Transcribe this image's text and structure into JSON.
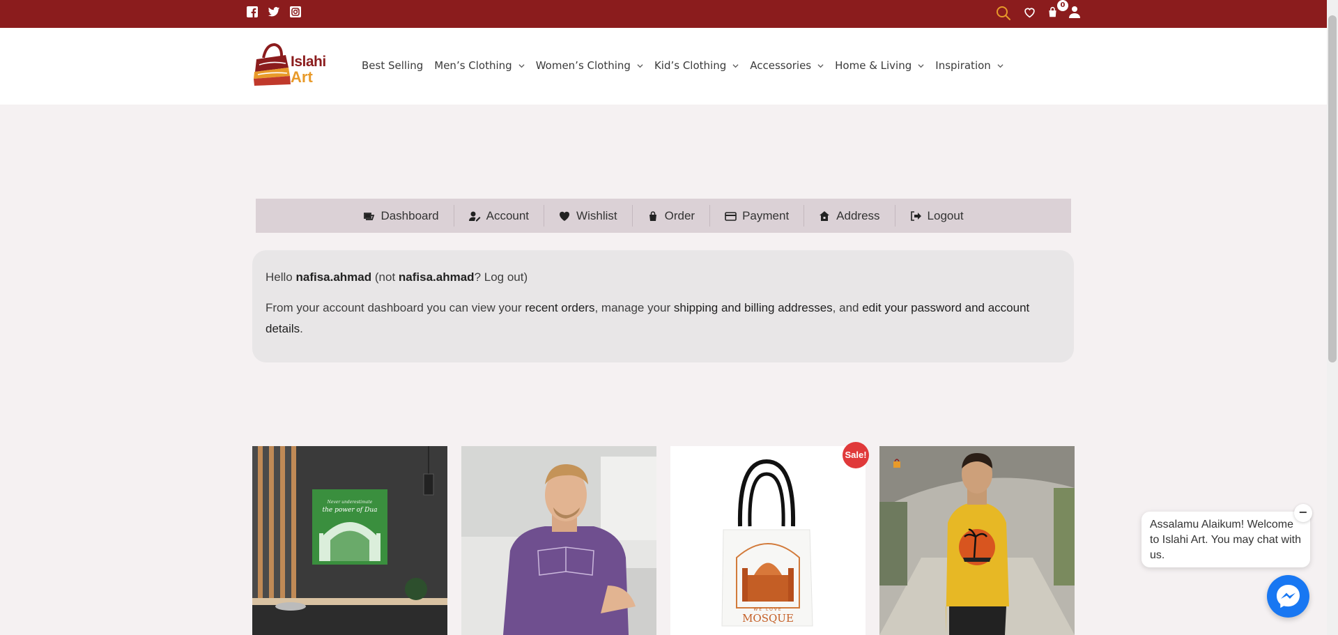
{
  "social": [
    {
      "icon": "facebook-icon"
    },
    {
      "icon": "twitter-icon"
    },
    {
      "icon": "instagram-icon"
    }
  ],
  "top": {
    "cart_count": "0"
  },
  "brand": {
    "line1": "Islahi",
    "line2": "Art"
  },
  "nav": [
    {
      "label": "Best Selling",
      "dropdown": false
    },
    {
      "label": "Men’s Clothing",
      "dropdown": true
    },
    {
      "label": "Women’s Clothing",
      "dropdown": true
    },
    {
      "label": "Kid’s Clothing",
      "dropdown": true
    },
    {
      "label": "Accessories",
      "dropdown": true
    },
    {
      "label": "Home & Living",
      "dropdown": true
    },
    {
      "label": "Inspiration",
      "dropdown": true
    }
  ],
  "account_tabs": [
    {
      "label": "Dashboard",
      "icon": "dashboard-icon"
    },
    {
      "label": "Account",
      "icon": "user-edit-icon"
    },
    {
      "label": "Wishlist",
      "icon": "heart-icon"
    },
    {
      "label": "Order",
      "icon": "shopping-bag-icon"
    },
    {
      "label": "Payment",
      "icon": "credit-card-icon"
    },
    {
      "label": "Address",
      "icon": "house-icon"
    },
    {
      "label": "Logout",
      "icon": "sign-out-icon"
    }
  ],
  "welcome": {
    "hello": "Hello",
    "username": "nafisa.ahmad",
    "not_open": "(not",
    "username2": "nafisa.ahmad",
    "logout_link": "? Log out)",
    "text1": "From your account dashboard you can view your",
    "link_orders": "recent orders",
    "text2": ", manage your",
    "link_addresses": "shipping and billing addresses",
    "text3": ", and",
    "link_password": "edit your password and account details",
    "text4": "."
  },
  "products": [
    {
      "image": "canvas-power-of-dua",
      "art_text_line1": "Never underestimate",
      "art_text_line2": "the power of Dua"
    },
    {
      "image": "man-purple-tshirt"
    },
    {
      "image": "we-love-mosque-tote",
      "sale_badge": "Sale!",
      "tote_text1": "WE LOVE",
      "tote_text2": "MOSQUE"
    },
    {
      "image": "man-yellow-palm-tshirt"
    }
  ],
  "chat": {
    "message": "Assalamu Alaikum! Welcome to Islahi Art. You may chat with us.",
    "close_label": "−"
  },
  "colors": {
    "topbar": "#8b1c1d",
    "accent": "#e89a2a",
    "tabbar": "#dbd1d6",
    "sale": "#e0393a",
    "messenger": "#1877f2"
  }
}
